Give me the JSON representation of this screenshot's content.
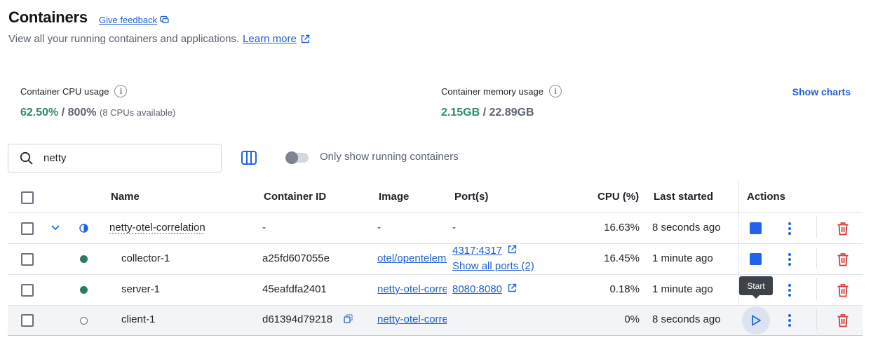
{
  "header": {
    "title": "Containers",
    "feedback_label": "Give feedback",
    "subtitle": "View all your running containers and applications.",
    "learn_more": "Learn more"
  },
  "stats": {
    "cpu": {
      "label": "Container CPU usage",
      "used": "62.50%",
      "total": "/ 800%",
      "note": "(8 CPUs available)"
    },
    "memory": {
      "label": "Container memory usage",
      "used": "2.15GB",
      "total": "/ 22.89GB"
    },
    "show_charts": "Show charts"
  },
  "toolbar": {
    "search_value": "netty",
    "running_toggle_label": "Only show running containers",
    "running_toggle_on": false
  },
  "table": {
    "columns": {
      "name": "Name",
      "container_id": "Container ID",
      "image": "Image",
      "ports": "Port(s)",
      "cpu": "CPU (%)",
      "last_started": "Last started",
      "actions": "Actions"
    },
    "rows": [
      {
        "name": "netty-otel-correlation",
        "container_id": "-",
        "image": "-",
        "port": "-",
        "port_extra": "",
        "cpu": "16.63%",
        "last_started": "8 seconds ago",
        "status": "partial",
        "action": "stop"
      },
      {
        "name": "collector-1",
        "container_id": "a25fd607055e",
        "image": "otel/opentelemetry-collector",
        "port": "4317:4317",
        "port_extra": "Show all ports (2)",
        "cpu": "16.45%",
        "last_started": "1 minute ago",
        "status": "running",
        "action": "stop"
      },
      {
        "name": "server-1",
        "container_id": "45eafdfa2401",
        "image": "netty-otel-correlation-server",
        "port": "8080:8080",
        "port_extra": "",
        "cpu": "0.18%",
        "last_started": "1 minute ago",
        "status": "running",
        "action": "stop"
      },
      {
        "name": "client-1",
        "container_id": "d61394d79218",
        "image": "netty-otel-correlation-client",
        "port": "",
        "port_extra": "",
        "cpu": "0%",
        "last_started": "8 seconds ago",
        "status": "stopped",
        "action": "start"
      }
    ],
    "tooltip": "Start"
  },
  "colors": {
    "accent": "#1e5fd8",
    "running": "#2b7a5e",
    "delete": "#d93a3a"
  }
}
